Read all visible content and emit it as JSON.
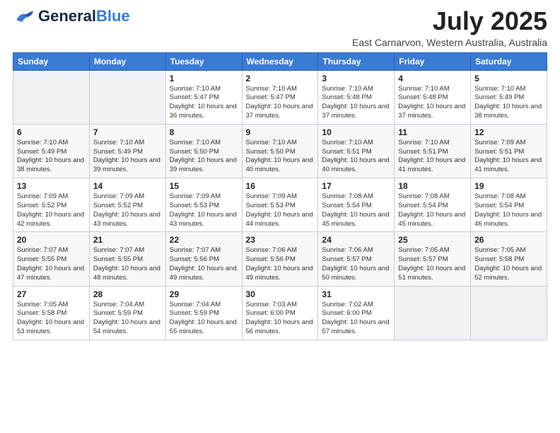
{
  "header": {
    "logo_general": "General",
    "logo_blue": "Blue",
    "month_year": "July 2025",
    "location": "East Carnarvon, Western Australia, Australia"
  },
  "days_of_week": [
    "Sunday",
    "Monday",
    "Tuesday",
    "Wednesday",
    "Thursday",
    "Friday",
    "Saturday"
  ],
  "weeks": [
    [
      {
        "day": "",
        "sunrise": "",
        "sunset": "",
        "daylight": "",
        "empty": true
      },
      {
        "day": "",
        "sunrise": "",
        "sunset": "",
        "daylight": "",
        "empty": true
      },
      {
        "day": "1",
        "sunrise": "Sunrise: 7:10 AM",
        "sunset": "Sunset: 5:47 PM",
        "daylight": "Daylight: 10 hours and 36 minutes."
      },
      {
        "day": "2",
        "sunrise": "Sunrise: 7:10 AM",
        "sunset": "Sunset: 5:47 PM",
        "daylight": "Daylight: 10 hours and 37 minutes."
      },
      {
        "day": "3",
        "sunrise": "Sunrise: 7:10 AM",
        "sunset": "Sunset: 5:48 PM",
        "daylight": "Daylight: 10 hours and 37 minutes."
      },
      {
        "day": "4",
        "sunrise": "Sunrise: 7:10 AM",
        "sunset": "Sunset: 5:48 PM",
        "daylight": "Daylight: 10 hours and 37 minutes."
      },
      {
        "day": "5",
        "sunrise": "Sunrise: 7:10 AM",
        "sunset": "Sunset: 5:49 PM",
        "daylight": "Daylight: 10 hours and 38 minutes."
      }
    ],
    [
      {
        "day": "6",
        "sunrise": "Sunrise: 7:10 AM",
        "sunset": "Sunset: 5:49 PM",
        "daylight": "Daylight: 10 hours and 38 minutes."
      },
      {
        "day": "7",
        "sunrise": "Sunrise: 7:10 AM",
        "sunset": "Sunset: 5:49 PM",
        "daylight": "Daylight: 10 hours and 39 minutes."
      },
      {
        "day": "8",
        "sunrise": "Sunrise: 7:10 AM",
        "sunset": "Sunset: 5:50 PM",
        "daylight": "Daylight: 10 hours and 39 minutes."
      },
      {
        "day": "9",
        "sunrise": "Sunrise: 7:10 AM",
        "sunset": "Sunset: 5:50 PM",
        "daylight": "Daylight: 10 hours and 40 minutes."
      },
      {
        "day": "10",
        "sunrise": "Sunrise: 7:10 AM",
        "sunset": "Sunset: 5:51 PM",
        "daylight": "Daylight: 10 hours and 40 minutes."
      },
      {
        "day": "11",
        "sunrise": "Sunrise: 7:10 AM",
        "sunset": "Sunset: 5:51 PM",
        "daylight": "Daylight: 10 hours and 41 minutes."
      },
      {
        "day": "12",
        "sunrise": "Sunrise: 7:09 AM",
        "sunset": "Sunset: 5:51 PM",
        "daylight": "Daylight: 10 hours and 41 minutes."
      }
    ],
    [
      {
        "day": "13",
        "sunrise": "Sunrise: 7:09 AM",
        "sunset": "Sunset: 5:52 PM",
        "daylight": "Daylight: 10 hours and 42 minutes."
      },
      {
        "day": "14",
        "sunrise": "Sunrise: 7:09 AM",
        "sunset": "Sunset: 5:52 PM",
        "daylight": "Daylight: 10 hours and 43 minutes."
      },
      {
        "day": "15",
        "sunrise": "Sunrise: 7:09 AM",
        "sunset": "Sunset: 5:53 PM",
        "daylight": "Daylight: 10 hours and 43 minutes."
      },
      {
        "day": "16",
        "sunrise": "Sunrise: 7:09 AM",
        "sunset": "Sunset: 5:53 PM",
        "daylight": "Daylight: 10 hours and 44 minutes."
      },
      {
        "day": "17",
        "sunrise": "Sunrise: 7:08 AM",
        "sunset": "Sunset: 5:54 PM",
        "daylight": "Daylight: 10 hours and 45 minutes."
      },
      {
        "day": "18",
        "sunrise": "Sunrise: 7:08 AM",
        "sunset": "Sunset: 5:54 PM",
        "daylight": "Daylight: 10 hours and 45 minutes."
      },
      {
        "day": "19",
        "sunrise": "Sunrise: 7:08 AM",
        "sunset": "Sunset: 5:54 PM",
        "daylight": "Daylight: 10 hours and 46 minutes."
      }
    ],
    [
      {
        "day": "20",
        "sunrise": "Sunrise: 7:07 AM",
        "sunset": "Sunset: 5:55 PM",
        "daylight": "Daylight: 10 hours and 47 minutes."
      },
      {
        "day": "21",
        "sunrise": "Sunrise: 7:07 AM",
        "sunset": "Sunset: 5:55 PM",
        "daylight": "Daylight: 10 hours and 48 minutes."
      },
      {
        "day": "22",
        "sunrise": "Sunrise: 7:07 AM",
        "sunset": "Sunset: 5:56 PM",
        "daylight": "Daylight: 10 hours and 49 minutes."
      },
      {
        "day": "23",
        "sunrise": "Sunrise: 7:06 AM",
        "sunset": "Sunset: 5:56 PM",
        "daylight": "Daylight: 10 hours and 49 minutes."
      },
      {
        "day": "24",
        "sunrise": "Sunrise: 7:06 AM",
        "sunset": "Sunset: 5:57 PM",
        "daylight": "Daylight: 10 hours and 50 minutes."
      },
      {
        "day": "25",
        "sunrise": "Sunrise: 7:05 AM",
        "sunset": "Sunset: 5:57 PM",
        "daylight": "Daylight: 10 hours and 51 minutes."
      },
      {
        "day": "26",
        "sunrise": "Sunrise: 7:05 AM",
        "sunset": "Sunset: 5:58 PM",
        "daylight": "Daylight: 10 hours and 52 minutes."
      }
    ],
    [
      {
        "day": "27",
        "sunrise": "Sunrise: 7:05 AM",
        "sunset": "Sunset: 5:58 PM",
        "daylight": "Daylight: 10 hours and 53 minutes."
      },
      {
        "day": "28",
        "sunrise": "Sunrise: 7:04 AM",
        "sunset": "Sunset: 5:59 PM",
        "daylight": "Daylight: 10 hours and 54 minutes."
      },
      {
        "day": "29",
        "sunrise": "Sunrise: 7:04 AM",
        "sunset": "Sunset: 5:59 PM",
        "daylight": "Daylight: 10 hours and 55 minutes."
      },
      {
        "day": "30",
        "sunrise": "Sunrise: 7:03 AM",
        "sunset": "Sunset: 6:00 PM",
        "daylight": "Daylight: 10 hours and 56 minutes."
      },
      {
        "day": "31",
        "sunrise": "Sunrise: 7:02 AM",
        "sunset": "Sunset: 6:00 PM",
        "daylight": "Daylight: 10 hours and 57 minutes."
      },
      {
        "day": "",
        "sunrise": "",
        "sunset": "",
        "daylight": "",
        "empty": true
      },
      {
        "day": "",
        "sunrise": "",
        "sunset": "",
        "daylight": "",
        "empty": true
      }
    ]
  ]
}
